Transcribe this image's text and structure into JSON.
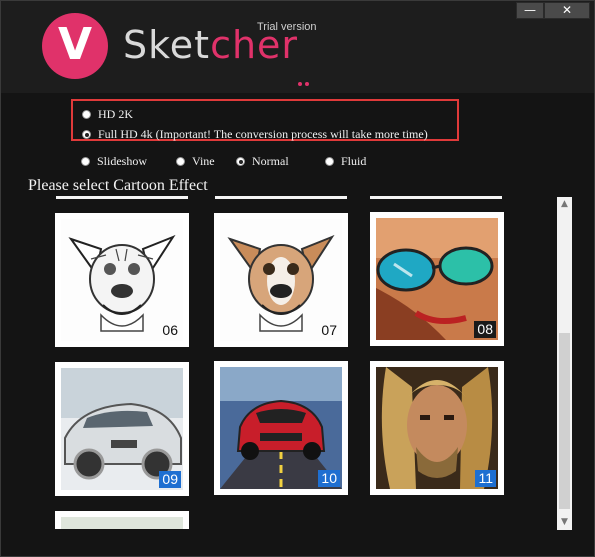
{
  "app": {
    "logo_letter": "V",
    "name_part1": "Sket",
    "name_part2": "cher",
    "edition": "Trial version"
  },
  "window_controls": {
    "minimize": "—",
    "close": "✕"
  },
  "resolution": {
    "options": [
      {
        "label": "HD 2K",
        "selected": false
      },
      {
        "label": "Full HD 4k (Important! The conversion process will take more time)",
        "selected": true
      }
    ]
  },
  "modes": [
    {
      "label": "Slideshow",
      "selected": false
    },
    {
      "label": "Vine",
      "selected": false
    },
    {
      "label": "Normal",
      "selected": true
    },
    {
      "label": "Fluid",
      "selected": false
    }
  ],
  "effects": {
    "title": "Please select Cartoon Effect",
    "items": [
      {
        "number": "06",
        "style": "pencil-sketch"
      },
      {
        "number": "07",
        "style": "color-sketch"
      },
      {
        "number": "08",
        "style": "pop-art"
      },
      {
        "number": "09",
        "style": "car-painting"
      },
      {
        "number": "10",
        "style": "car-cartoon"
      },
      {
        "number": "11",
        "style": "portrait-painting"
      }
    ]
  },
  "colors": {
    "accent": "#e0326a",
    "highlight_border": "#e03a3a",
    "badge_blue": "#1e6fd1"
  }
}
